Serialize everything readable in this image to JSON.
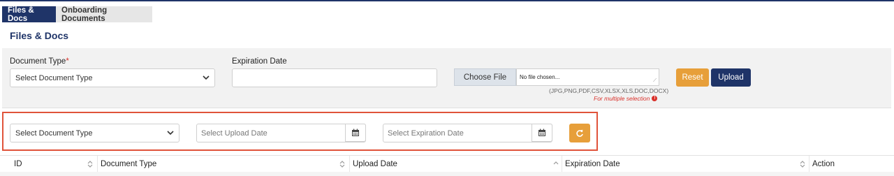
{
  "tabs": [
    {
      "label": "Files & Docs",
      "active": true
    },
    {
      "label": "Onboarding Documents",
      "active": false
    }
  ],
  "page_title": "Files & Docs",
  "upload_form": {
    "document_type_label": "Document Type",
    "required_mark": "*",
    "document_type_value": "Select Document Type",
    "expiration_date_label": "Expiration Date",
    "expiration_date_value": "",
    "choose_file_label": "Choose File",
    "file_chosen_text": "No file chosen...",
    "allowed_types_hint": "(JPG,PNG,PDF,CSV,XLSX,XLS,DOC,DOCX)",
    "multiple_selection_hint": "For multiple selection",
    "reset_label": "Reset",
    "upload_label": "Upload"
  },
  "filters": {
    "document_type_value": "Select Document Type",
    "upload_date_placeholder": "Select Upload Date",
    "expiration_date_placeholder": "Select Expiration Date"
  },
  "table": {
    "columns": [
      "ID",
      "Document Type",
      "Upload Date",
      "Expiration Date",
      "Action"
    ]
  },
  "colors": {
    "primary": "#1f3468",
    "accent": "#e79f3a",
    "required": "#d9302a",
    "highlight_outline": "#e0533a"
  },
  "icons": [
    "chevron-down-icon",
    "calendar-icon",
    "refresh-icon",
    "sort-icon",
    "info-icon"
  ]
}
